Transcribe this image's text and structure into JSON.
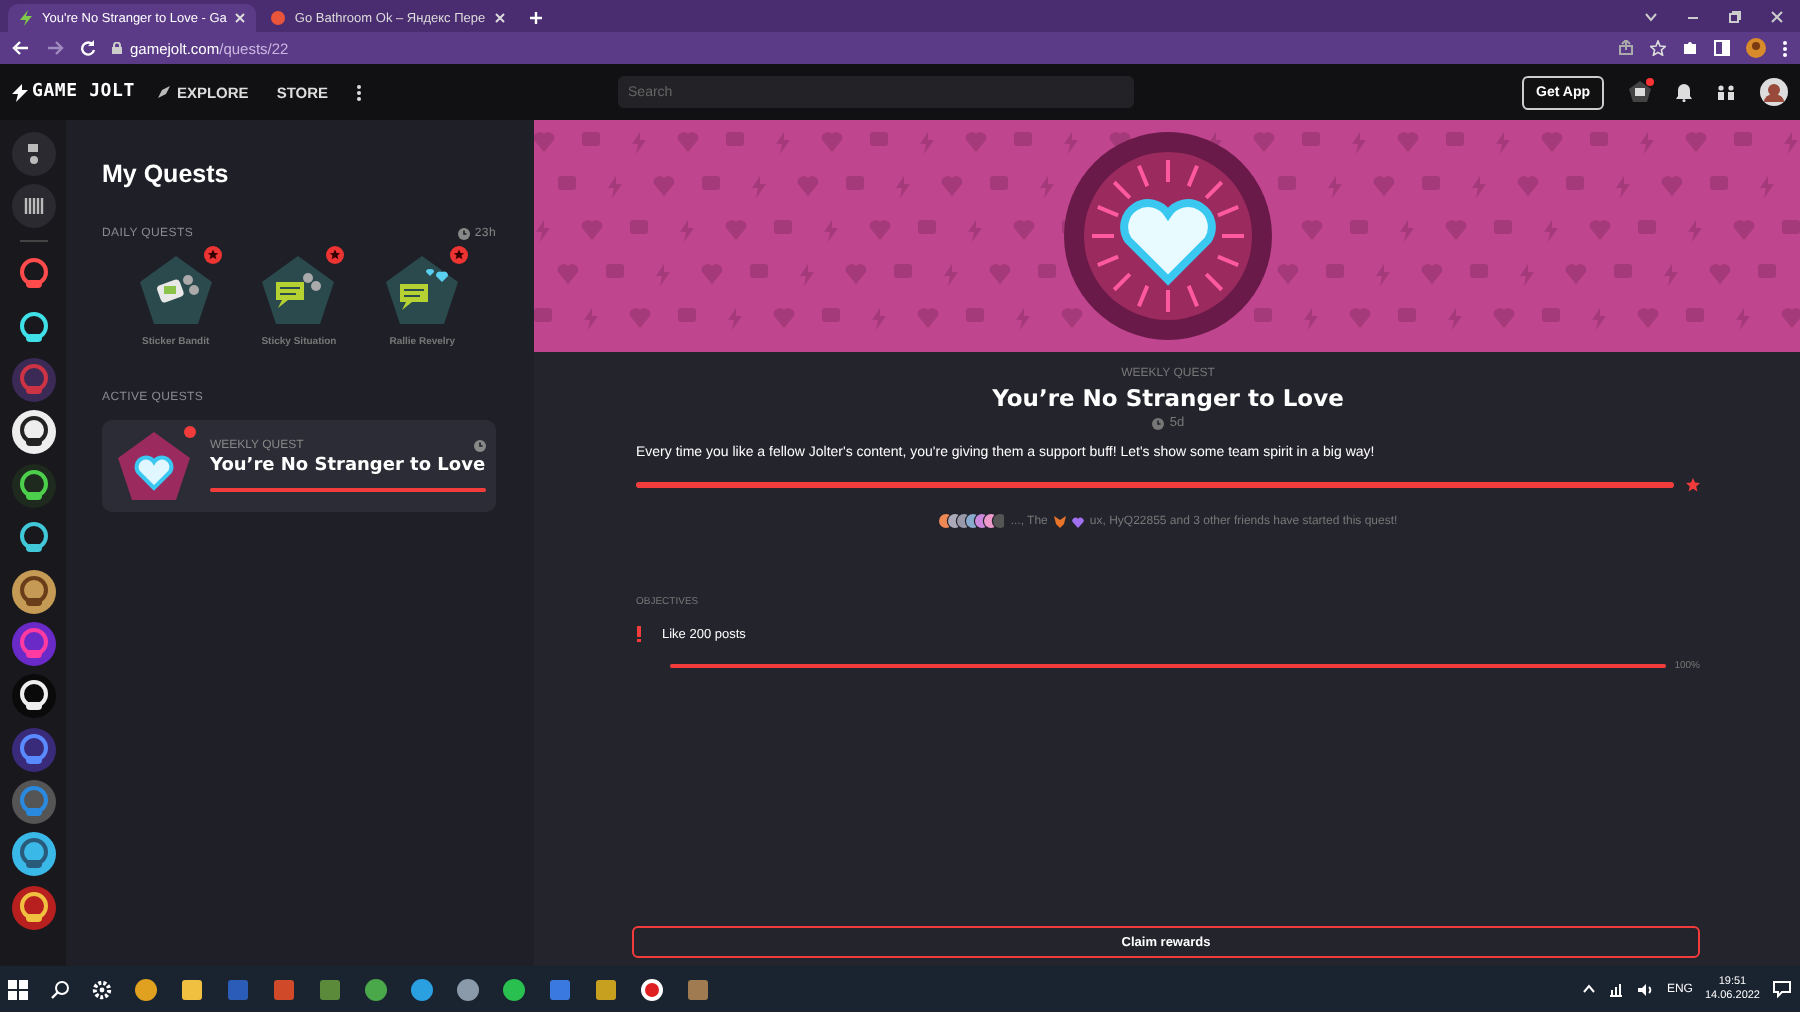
{
  "browser": {
    "tabs": [
      {
        "title": "You're No Stranger to Love - Ga",
        "selected": true
      },
      {
        "title": "Go Bathroom Ok – Яндекс Пере",
        "selected": false
      }
    ],
    "url_host": "gamejolt.com",
    "url_path": "/quests/22"
  },
  "site_header": {
    "logo": "GAME JOLT",
    "nav": [
      {
        "label": "EXPLORE",
        "kind": "explore"
      },
      {
        "label": "STORE",
        "kind": "plain"
      }
    ],
    "search": {
      "placeholder": "Search"
    },
    "get_app": "Get App",
    "quest_notification": true
  },
  "sidebar": {
    "title": "My Quests",
    "daily": {
      "heading": "DAILY QUESTS",
      "timer": "23h",
      "quests": [
        {
          "name": "Sticker Bandit",
          "kind": "sticker",
          "new": true
        },
        {
          "name": "Sticky Situation",
          "kind": "chat",
          "new": true
        },
        {
          "name": "Rallie Revelry",
          "kind": "heart-chat",
          "new": true
        }
      ]
    },
    "active": {
      "heading": "ACTIVE QUESTS",
      "quests": [
        {
          "type": "WEEKLY QUEST",
          "title": "You’re No Stranger to Love",
          "level": 1,
          "new": true
        }
      ]
    }
  },
  "quest": {
    "type": "WEEKLY QUEST",
    "title": "You’re No Stranger to Love",
    "timer": "5d",
    "description": "Every time you like a fellow Jolter's content, you're giving them a support buff! Let's show some team spirit in a big way!",
    "level": 1,
    "friends": {
      "prefix": "..., The",
      "suffix": "ux, HyQ22855 and 3 other friends have started this quest!"
    },
    "objectives_heading": "OBJECTIVES",
    "objectives": [
      {
        "label": "Like 200 posts",
        "level": 1,
        "percent": "100%"
      }
    ],
    "claim": "Claim rewards"
  },
  "taskbar": {
    "language": "ENG",
    "time": "19:51",
    "date": "14.06.2022"
  }
}
